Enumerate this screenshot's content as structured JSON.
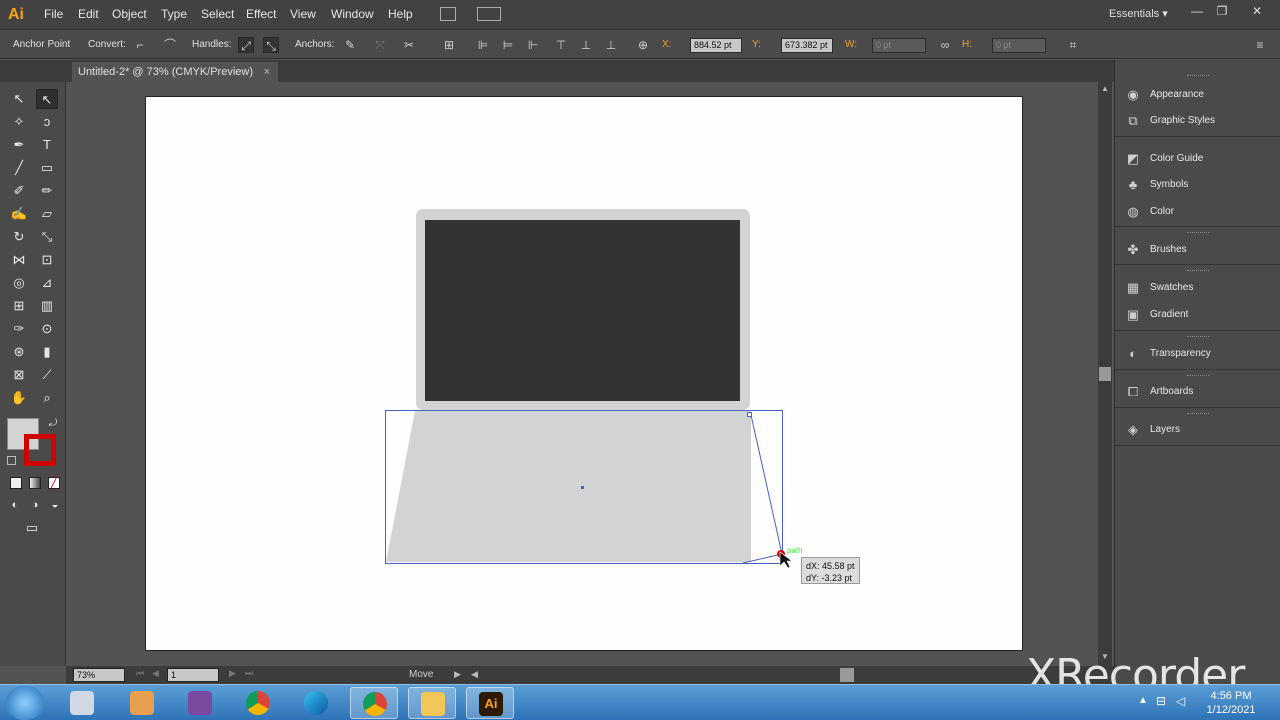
{
  "app": {
    "logo": "Ai"
  },
  "menu": [
    "File",
    "Edit",
    "Object",
    "Type",
    "Select",
    "Effect",
    "View",
    "Window",
    "Help"
  ],
  "workspace": "Essentials ▾",
  "window_controls": [
    "—",
    "❐",
    "✕"
  ],
  "control_bar": {
    "mode": "Anchor Point",
    "convert_label": "Convert:",
    "handles_label": "Handles:",
    "anchors_label": "Anchors:",
    "x_key": "X:",
    "x_value": "884.52 pt",
    "y_key": "Y:",
    "y_value": "673.382 pt",
    "w_key": "W:",
    "w_value": "0 pt",
    "h_key": "H:",
    "h_value": "0 pt"
  },
  "document": {
    "tab_title": "Untitled-2* @ 73% (CMYK/Preview)",
    "tab_close": "×"
  },
  "artboard": {
    "colors": {
      "lid": "#d2d3d4",
      "screen": "#333333",
      "base": "#d2d3d4",
      "selection": "#4a5fc1"
    },
    "smart_guide": "path",
    "readout_dx": "dX: 45.58 pt",
    "readout_dy": "dY: -3.23 pt"
  },
  "status_bar": {
    "zoom": "73%",
    "artboard_number": "1",
    "status": "Move"
  },
  "panels": [
    {
      "label": "Appearance",
      "icon": "appearance-icon"
    },
    {
      "label": "Graphic Styles",
      "icon": "graphic-styles-icon"
    },
    {
      "label": "Color Guide",
      "icon": "color-guide-icon"
    },
    {
      "label": "Symbols",
      "icon": "symbols-icon"
    },
    {
      "label": "Color",
      "icon": "color-icon"
    },
    {
      "label": "Brushes",
      "icon": "brushes-icon"
    },
    {
      "label": "Swatches",
      "icon": "swatches-icon"
    },
    {
      "label": "Gradient",
      "icon": "gradient-icon"
    },
    {
      "label": "Transparency",
      "icon": "transparency-icon"
    },
    {
      "label": "Artboards",
      "icon": "artboards-icon"
    },
    {
      "label": "Layers",
      "icon": "layers-icon"
    }
  ],
  "taskbar": {
    "time": "4:56 PM",
    "date": "1/12/2021",
    "apps": [
      "calculator",
      "paint",
      "winrar",
      "chrome",
      "edge",
      "chrome-profile",
      "file-explorer",
      "illustrator"
    ]
  },
  "watermark": "XRecorder"
}
